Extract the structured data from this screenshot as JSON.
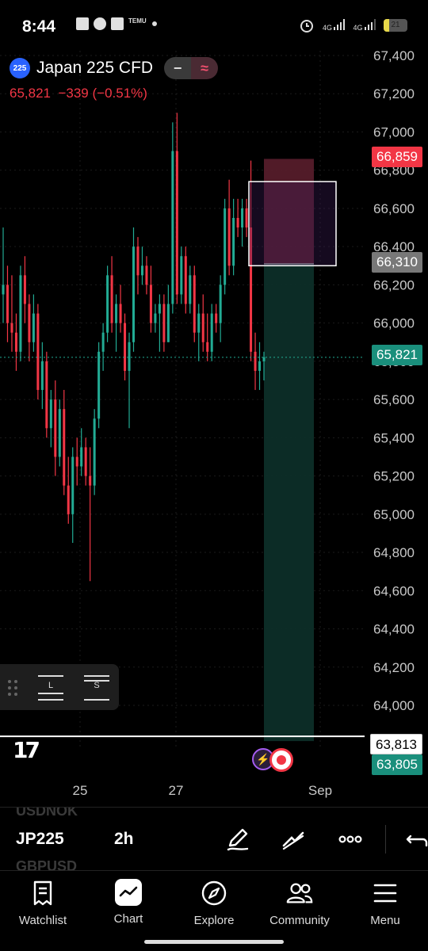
{
  "status_bar": {
    "time": "8:44",
    "temu_label": "TEMU",
    "network_1": "4G",
    "network_2": "4G",
    "battery": "21"
  },
  "symbol": {
    "badge": "225",
    "name": "Japan 225 CFD",
    "price": "65,821",
    "change": "−339",
    "change_pct": "(−0.51%)"
  },
  "price_axis": {
    "ticks": [
      "67,400",
      "67,200",
      "67,000",
      "66,800",
      "66,600",
      "66,400",
      "66,200",
      "66,000",
      "65,800",
      "65,600",
      "65,400",
      "65,200",
      "65,000",
      "64,800",
      "64,600",
      "64,400",
      "64,200",
      "64,000"
    ],
    "labels": {
      "stop": "66,859",
      "entry": "66,310",
      "current": "65,821",
      "target": "63,813",
      "target_sub": "63,805"
    }
  },
  "time_axis": [
    "25",
    "27",
    "Sep"
  ],
  "tools": {
    "long_label": "L",
    "short_label": "S"
  },
  "ticker_bar": {
    "ghost_above": "USDNOK",
    "ghost_below": "GBPUSD",
    "symbol": "JP225",
    "interval": "2h"
  },
  "nav": {
    "items": [
      {
        "label": "Watchlist",
        "icon": "watchlist-icon"
      },
      {
        "label": "Chart",
        "icon": "chart-icon"
      },
      {
        "label": "Explore",
        "icon": "compass-icon"
      },
      {
        "label": "Community",
        "icon": "community-icon"
      },
      {
        "label": "Menu",
        "icon": "menu-icon"
      }
    ]
  },
  "colors": {
    "up": "#22ab94",
    "down": "#f23645",
    "background": "#000000",
    "loss_zone": "#5a1e2c",
    "profit_zone": "#0d2e28"
  },
  "chart_data": {
    "type": "candlestick",
    "instrument": "Japan 225 CFD",
    "interval": "2h",
    "ylim": [
      63800,
      67450
    ],
    "y_ticks": [
      67400,
      67200,
      67000,
      66800,
      66600,
      66400,
      66200,
      66000,
      65800,
      65600,
      65400,
      65200,
      65000,
      64800,
      64600,
      64400,
      64200,
      64000
    ],
    "x_labels": [
      "25",
      "27",
      "Sep"
    ],
    "candles": [
      {
        "o": 66150,
        "h": 66500,
        "l": 66000,
        "c": 66200
      },
      {
        "o": 66200,
        "h": 66300,
        "l": 65900,
        "c": 66000
      },
      {
        "o": 66000,
        "h": 66250,
        "l": 65850,
        "c": 65950
      },
      {
        "o": 65950,
        "h": 66050,
        "l": 65750,
        "c": 65850
      },
      {
        "o": 65850,
        "h": 66300,
        "l": 65800,
        "c": 66250
      },
      {
        "o": 66250,
        "h": 66350,
        "l": 66000,
        "c": 66100
      },
      {
        "o": 66100,
        "h": 66150,
        "l": 65800,
        "c": 65900
      },
      {
        "o": 65900,
        "h": 66150,
        "l": 65850,
        "c": 66050
      },
      {
        "o": 66050,
        "h": 66100,
        "l": 65600,
        "c": 65650
      },
      {
        "o": 65650,
        "h": 65900,
        "l": 65550,
        "c": 65800
      },
      {
        "o": 65800,
        "h": 65850,
        "l": 65400,
        "c": 65450
      },
      {
        "o": 65450,
        "h": 65650,
        "l": 65350,
        "c": 65600
      },
      {
        "o": 65600,
        "h": 65700,
        "l": 65200,
        "c": 65300
      },
      {
        "o": 65300,
        "h": 65600,
        "l": 65250,
        "c": 65550
      },
      {
        "o": 65550,
        "h": 65650,
        "l": 65100,
        "c": 65150
      },
      {
        "o": 65150,
        "h": 65300,
        "l": 64950,
        "c": 65000
      },
      {
        "o": 65000,
        "h": 65350,
        "l": 64850,
        "c": 65300
      },
      {
        "o": 65300,
        "h": 65400,
        "l": 65150,
        "c": 65250
      },
      {
        "o": 65250,
        "h": 65450,
        "l": 65200,
        "c": 65350
      },
      {
        "o": 65350,
        "h": 65400,
        "l": 65150,
        "c": 65200
      },
      {
        "o": 65200,
        "h": 65350,
        "l": 64650,
        "c": 65150
      },
      {
        "o": 65150,
        "h": 65550,
        "l": 65100,
        "c": 65500
      },
      {
        "o": 65500,
        "h": 65900,
        "l": 65450,
        "c": 65850
      },
      {
        "o": 65850,
        "h": 66000,
        "l": 65750,
        "c": 65950
      },
      {
        "o": 65950,
        "h": 66300,
        "l": 65900,
        "c": 66250
      },
      {
        "o": 66250,
        "h": 66350,
        "l": 65950,
        "c": 66000
      },
      {
        "o": 66000,
        "h": 66150,
        "l": 65850,
        "c": 66100
      },
      {
        "o": 66100,
        "h": 66200,
        "l": 65950,
        "c": 66000
      },
      {
        "o": 66000,
        "h": 66050,
        "l": 65700,
        "c": 65750
      },
      {
        "o": 65750,
        "h": 65950,
        "l": 65450,
        "c": 65900
      },
      {
        "o": 65900,
        "h": 66500,
        "l": 65850,
        "c": 66400
      },
      {
        "o": 66400,
        "h": 66450,
        "l": 66150,
        "c": 66250
      },
      {
        "o": 66250,
        "h": 66400,
        "l": 66200,
        "c": 66300
      },
      {
        "o": 66300,
        "h": 66350,
        "l": 66150,
        "c": 66200
      },
      {
        "o": 66200,
        "h": 66300,
        "l": 65950,
        "c": 66000
      },
      {
        "o": 66000,
        "h": 66100,
        "l": 65950,
        "c": 66050
      },
      {
        "o": 66050,
        "h": 66150,
        "l": 65850,
        "c": 66100
      },
      {
        "o": 66100,
        "h": 66150,
        "l": 65850,
        "c": 65900
      },
      {
        "o": 65900,
        "h": 66200,
        "l": 65900,
        "c": 66100
      },
      {
        "o": 66100,
        "h": 67050,
        "l": 66050,
        "c": 66900
      },
      {
        "o": 66900,
        "h": 67100,
        "l": 66100,
        "c": 66150
      },
      {
        "o": 66150,
        "h": 66400,
        "l": 66100,
        "c": 66350
      },
      {
        "o": 66350,
        "h": 66400,
        "l": 66050,
        "c": 66100
      },
      {
        "o": 66100,
        "h": 66300,
        "l": 66050,
        "c": 66250
      },
      {
        "o": 66250,
        "h": 66300,
        "l": 65900,
        "c": 65950
      },
      {
        "o": 65950,
        "h": 66100,
        "l": 65800,
        "c": 66050
      },
      {
        "o": 66050,
        "h": 66150,
        "l": 65850,
        "c": 65900
      },
      {
        "o": 65900,
        "h": 66050,
        "l": 65800,
        "c": 65850
      },
      {
        "o": 65850,
        "h": 66100,
        "l": 65800,
        "c": 66050
      },
      {
        "o": 66050,
        "h": 66100,
        "l": 65950,
        "c": 66000
      },
      {
        "o": 66000,
        "h": 66250,
        "l": 65900,
        "c": 66200
      },
      {
        "o": 66200,
        "h": 66650,
        "l": 66150,
        "c": 66600
      },
      {
        "o": 66600,
        "h": 66750,
        "l": 66250,
        "c": 66300
      },
      {
        "o": 66300,
        "h": 66650,
        "l": 66250,
        "c": 66550
      },
      {
        "o": 66550,
        "h": 66650,
        "l": 66450,
        "c": 66500
      },
      {
        "o": 66500,
        "h": 66650,
        "l": 66400,
        "c": 66600
      },
      {
        "o": 66600,
        "h": 66650,
        "l": 66450,
        "c": 66500
      },
      {
        "o": 66500,
        "h": 66850,
        "l": 65800,
        "c": 65850
      },
      {
        "o": 65850,
        "h": 65950,
        "l": 65650,
        "c": 65750
      },
      {
        "o": 65750,
        "h": 65900,
        "l": 65650,
        "c": 65800
      },
      {
        "o": 65800,
        "h": 65850,
        "l": 65700,
        "c": 65821
      }
    ],
    "position": {
      "type": "short",
      "stop": 66859,
      "entry": 66310,
      "target": 63813
    },
    "selection_box": {
      "high": 66740,
      "low": 66300
    },
    "current_price": 65821
  }
}
